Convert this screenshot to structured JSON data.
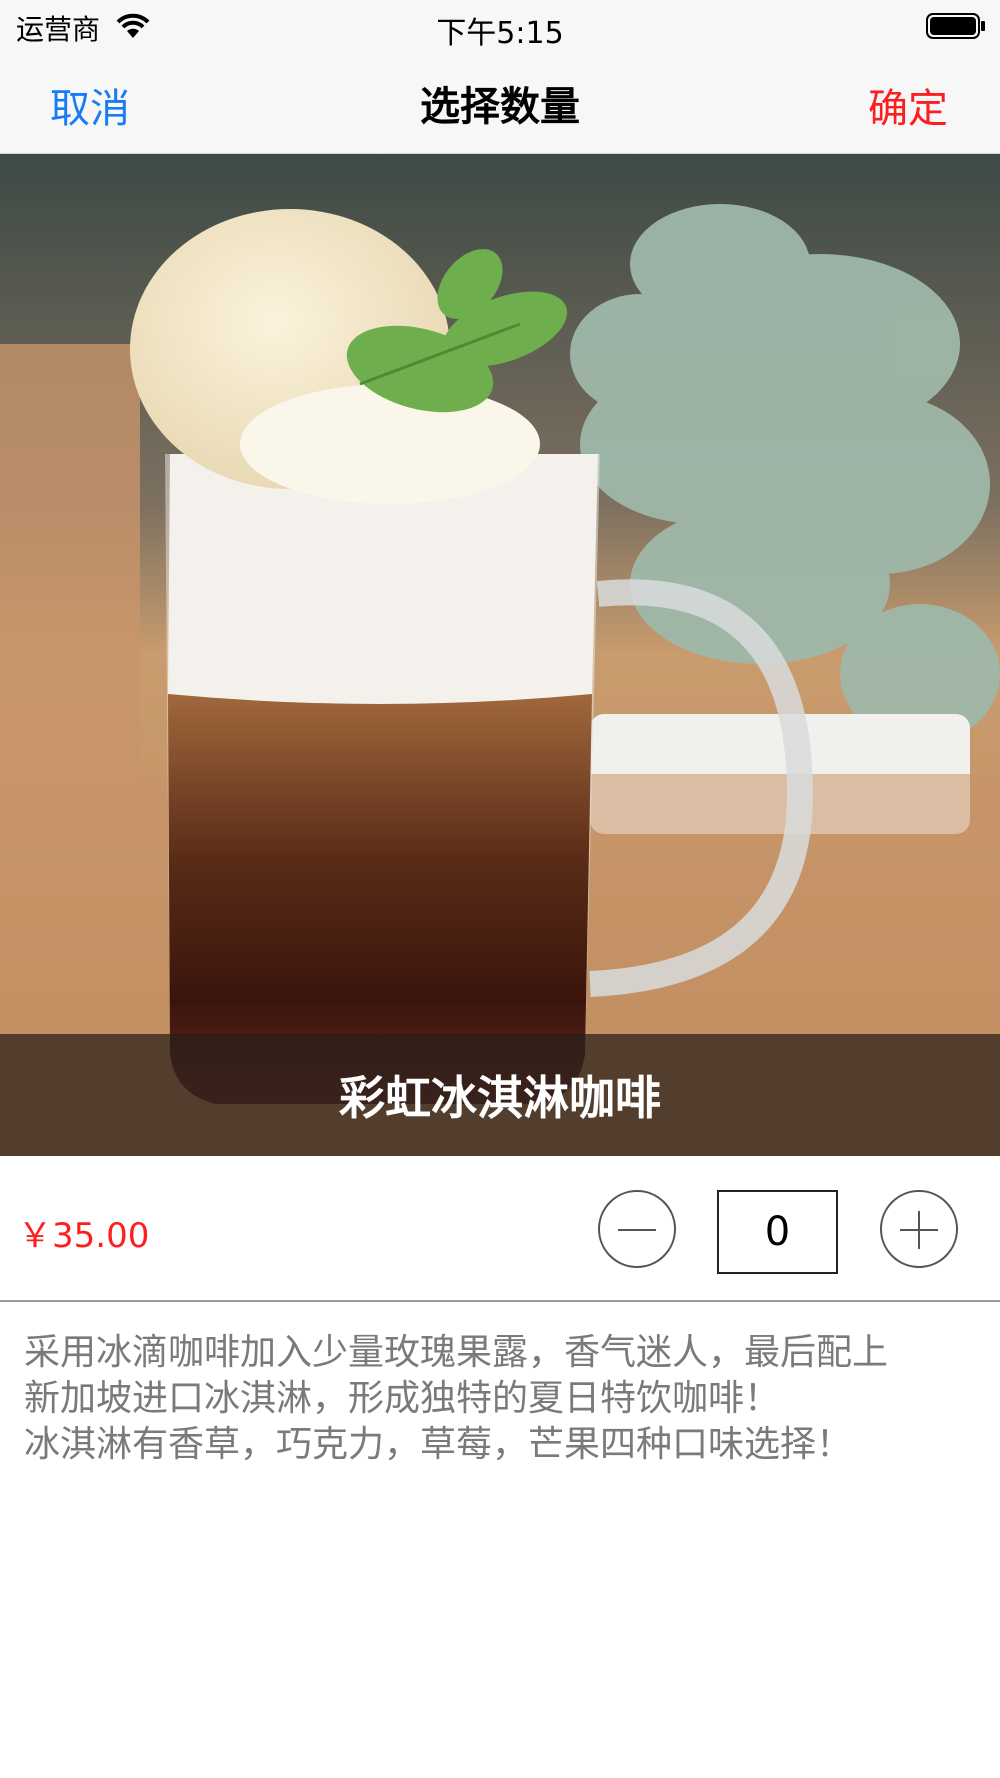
{
  "status_bar": {
    "carrier": "运营商",
    "time": "下午5:15",
    "wifi_icon": "wifi-icon",
    "battery_icon": "battery-icon"
  },
  "nav": {
    "cancel_label": "取消",
    "title": "选择数量",
    "confirm_label": "确定"
  },
  "product": {
    "name": "彩虹冰淇淋咖啡",
    "price": "￥35.00",
    "quantity": "0",
    "description_lines": [
      "采用冰滴咖啡加入少量玫瑰果露，香气迷人，最后配上",
      "新加坡进口冰淇淋，形成独特的夏日特饮咖啡！",
      "冰淇淋有香草，巧克力，草莓，芒果四种口味选择！"
    ]
  },
  "colors": {
    "cancel": "#1a7cf5",
    "confirm": "#ff1e1e",
    "price": "#ff1e1e",
    "description": "#7a7a7a"
  }
}
